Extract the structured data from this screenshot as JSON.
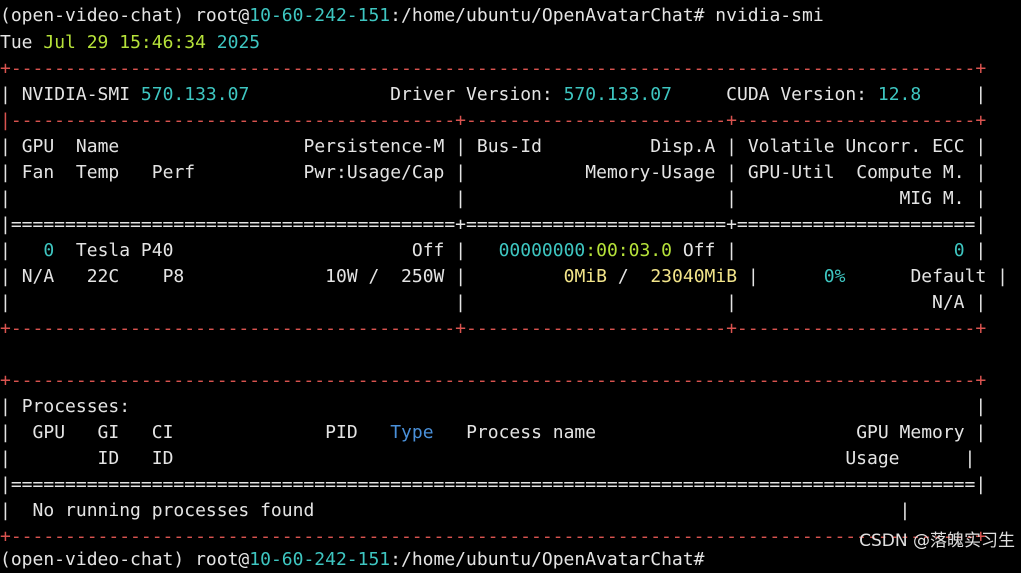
{
  "terminal": {
    "prompt": {
      "env": "(open-video-chat)",
      "user_at": "root@",
      "host": "10-60-242-151",
      "path": ":/home/ubuntu/OpenAvatarChat#",
      "command": "nvidia-smi"
    },
    "date": {
      "dow": "Tue",
      "month_day": "Jul 29",
      "time": "15:46:34",
      "year": "2025"
    }
  },
  "smi": {
    "header": {
      "smi_label": "NVIDIA-SMI",
      "smi_version": "570.133.07",
      "driver_label": "Driver Version:",
      "driver_version": "570.133.07",
      "cuda_label": "CUDA Version:",
      "cuda_version": "12.8"
    },
    "columns": {
      "row1": [
        "GPU",
        "Name",
        "Persistence-M",
        "Bus-Id",
        "Disp.A",
        "Volatile Uncorr. ECC"
      ],
      "row2": [
        "Fan",
        "Temp",
        "Perf",
        "Pwr:Usage/Cap",
        "Memory-Usage",
        "GPU-Util",
        "Compute M."
      ],
      "row3": [
        "MIG M."
      ]
    },
    "gpu": {
      "index": "0",
      "name": "Tesla P40",
      "persistence": "Off",
      "bus_id_prefix": "00000000",
      "bus_id_suffix": ":00:03.0",
      "disp_a": "Off",
      "ecc": "0",
      "fan": "N/A",
      "temp": "22C",
      "perf": "P8",
      "power_usage": "10W",
      "power_cap": "250W",
      "mem_used": "0MiB",
      "mem_total": "23040MiB",
      "gpu_util": "0%",
      "compute_mode": "Default",
      "mig_mode": "N/A"
    },
    "processes": {
      "title": "Processes:",
      "cols": [
        "GPU",
        "GI",
        "CI",
        "PID",
        "Type",
        "Process name",
        "GPU Memory"
      ],
      "cols2": [
        "ID",
        "ID",
        "Usage"
      ],
      "empty": "No running processes found"
    }
  },
  "watermark": "CSDN @落魄实习生"
}
